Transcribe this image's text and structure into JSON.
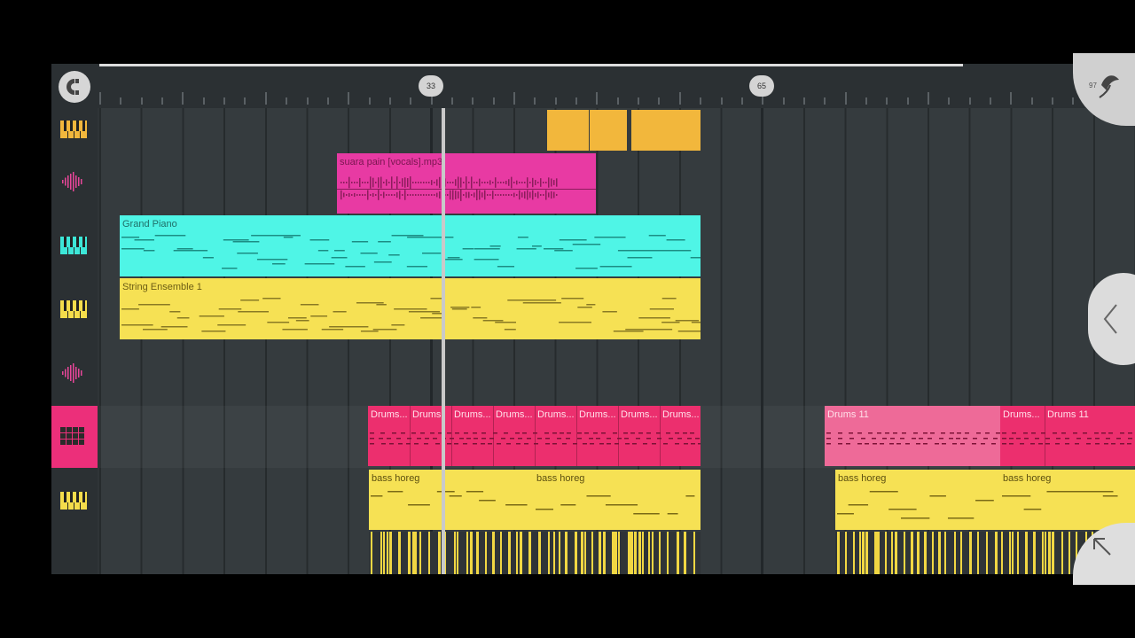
{
  "ruler": {
    "markers": [
      "33",
      "65"
    ]
  },
  "corner": {
    "label": "97"
  },
  "clips": {
    "vocal": "suara pain [vocals].mp3",
    "piano": "Grand Piano",
    "strings": "String Ensemble 1",
    "drums": [
      "Drums...",
      "Drums",
      "Drums...",
      "Drums...",
      "Drums...",
      "Drums...",
      "Drums...",
      "Drums..."
    ],
    "drums_right": [
      "Drums 11",
      "Drums...",
      "Drums 11"
    ],
    "bass": [
      "bass horeg",
      "bass horeg",
      "bass horeg",
      "bass horeg"
    ]
  },
  "tracks": [
    {
      "icon": "piano-icon",
      "color": "#f2b73c"
    },
    {
      "icon": "waveform-icon",
      "color": "#e8469a"
    },
    {
      "icon": "piano-icon",
      "color": "#3de7d8"
    },
    {
      "icon": "piano-icon",
      "color": "#f5dd4b"
    },
    {
      "icon": "waveform-icon",
      "color": "#e8469a"
    },
    {
      "icon": "drum-pad-icon",
      "color": "#ec2f7a"
    },
    {
      "icon": "piano-icon",
      "color": "#f5dd4b"
    }
  ],
  "colors": {
    "orange": "#f2b73c",
    "pink": "#e83aa3",
    "cyan": "#4ff5e6",
    "yellow": "#f6e154",
    "drums": "#ec2f6e"
  }
}
